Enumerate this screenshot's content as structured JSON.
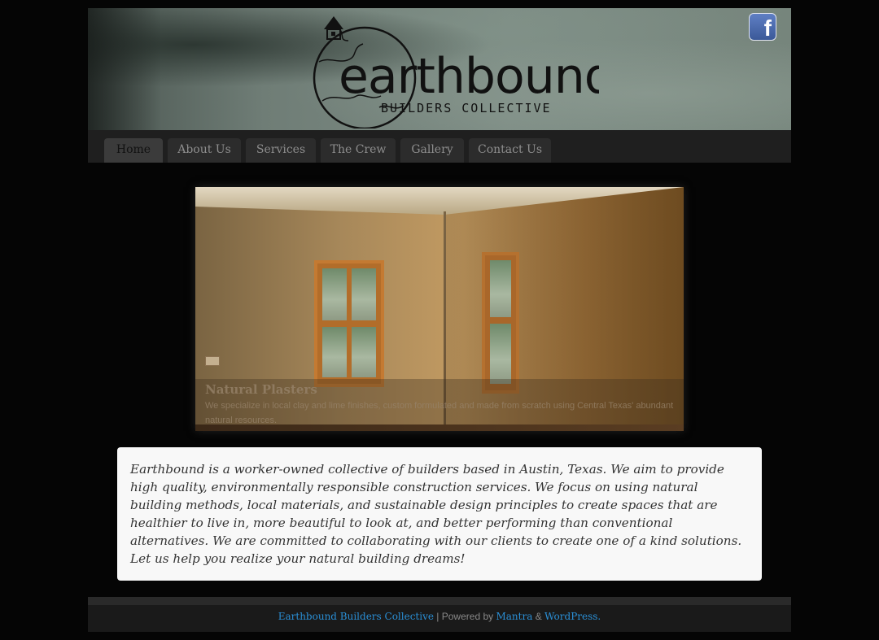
{
  "header": {
    "logo": {
      "wordmark": "earthbound",
      "tagline": "BUILDERS COLLECTIVE"
    },
    "social_icon": "facebook-icon",
    "social_glyph": "f"
  },
  "nav": {
    "items": [
      {
        "label": "Home"
      },
      {
        "label": "About Us"
      },
      {
        "label": "Services"
      },
      {
        "label": "The Crew"
      },
      {
        "label": "Gallery"
      },
      {
        "label": "Contact Us"
      }
    ],
    "active": "Home"
  },
  "slider": {
    "caption_title": "Natural Plasters",
    "caption_text": "We specialize in local clay and lime finishes, custom formulated and made from scratch using Central Texas' abundant natural resources."
  },
  "intro": {
    "text": "Earthbound is a worker-owned collective of builders based in Austin, Texas. We aim to provide high quality, environmentally responsible construction services. We focus on using natural building methods, local materials, and sustainable design principles to create spaces that are healthier to live in, more beautiful to look at, and better performing than conventional alternatives. We are committed to collaborating with our clients to create one of a kind solutions. Let us help you realize your natural building dreams!"
  },
  "footer": {
    "site_link": "Earthbound Builders Collective",
    "separator": " | Powered by ",
    "theme_link": "Mantra",
    "amp": " & ",
    "platform_link": "WordPress."
  },
  "colors": {
    "background": "#050505",
    "nav_bar": "#1f1f1f",
    "link": "#2a8fd6",
    "content_box": "#f8f8f8"
  }
}
